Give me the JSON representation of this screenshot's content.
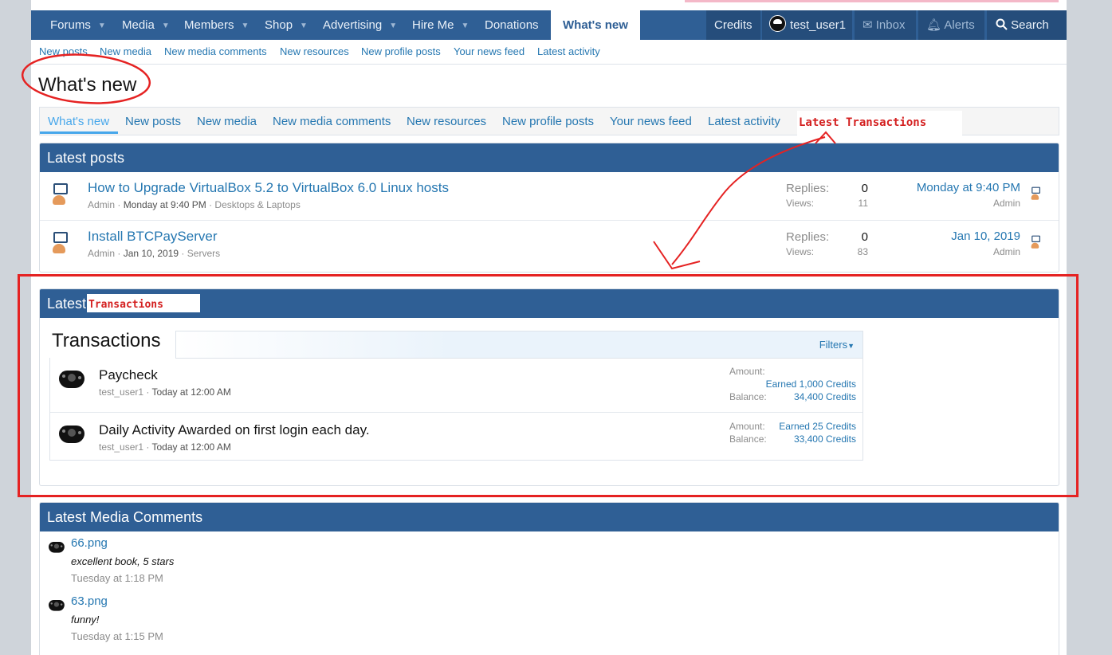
{
  "nav": {
    "items": [
      {
        "label": "Forums"
      },
      {
        "label": "Media"
      },
      {
        "label": "Members"
      },
      {
        "label": "Shop"
      },
      {
        "label": "Advertising"
      },
      {
        "label": "Hire Me"
      },
      {
        "label": "Donations"
      },
      {
        "label": "What's new"
      }
    ],
    "credits": "Credits",
    "user": "test_user1",
    "inbox": "Inbox",
    "alerts": "Alerts",
    "search": "Search"
  },
  "subnav": [
    "New posts",
    "New media",
    "New media comments",
    "New resources",
    "New profile posts",
    "Your news feed",
    "Latest activity"
  ],
  "page_title": "What's new",
  "tabs": [
    "What's new",
    "New posts",
    "New media",
    "New media comments",
    "New resources",
    "New profile posts",
    "Your news feed",
    "Latest activity"
  ],
  "annotation_label": "Latest Transactions",
  "latest_posts": {
    "title": "Latest posts",
    "labels": {
      "replies": "Replies:",
      "views": "Views:"
    },
    "rows": [
      {
        "title": "How to Upgrade VirtualBox 5.2 to VirtualBox 6.0 Linux hosts",
        "author": "Admin",
        "date": "Monday at 9:40 PM",
        "forum": "Desktops & Laptops",
        "replies": "0",
        "views": "11",
        "last_date": "Monday at 9:40 PM",
        "last_user": "Admin"
      },
      {
        "title": "Install BTCPayServer",
        "author": "Admin",
        "date": "Jan 10, 2019",
        "forum": "Servers",
        "replies": "0",
        "views": "83",
        "last_date": "Jan 10, 2019",
        "last_user": "Admin"
      }
    ]
  },
  "latest_tx": {
    "title_prefix": "Latest",
    "title_anno": "Transactions",
    "heading": "Transactions",
    "filters": "Filters",
    "labels": {
      "amount": "Amount:",
      "balance": "Balance:"
    },
    "rows": [
      {
        "name": "Paycheck",
        "user": "test_user1",
        "time": "Today at 12:00 AM",
        "amount": "Earned 1,000 Credits",
        "balance": "34,400 Credits"
      },
      {
        "name": "Daily Activity Awarded on first login each day.",
        "user": "test_user1",
        "time": "Today at 12:00 AM",
        "amount": "Earned 25 Credits",
        "balance": "33,400 Credits"
      }
    ]
  },
  "media_comments": {
    "title": "Latest Media Comments",
    "items": [
      {
        "name": "66.png",
        "comment": "excellent book, 5 stars",
        "time": "Tuesday at 1:18 PM"
      },
      {
        "name": "63.png",
        "comment": "funny!",
        "time": "Tuesday at 1:15 PM"
      }
    ]
  },
  "colors": {
    "nav": "#2f5f95",
    "link": "#2577b1",
    "annotation": "#e52222"
  }
}
